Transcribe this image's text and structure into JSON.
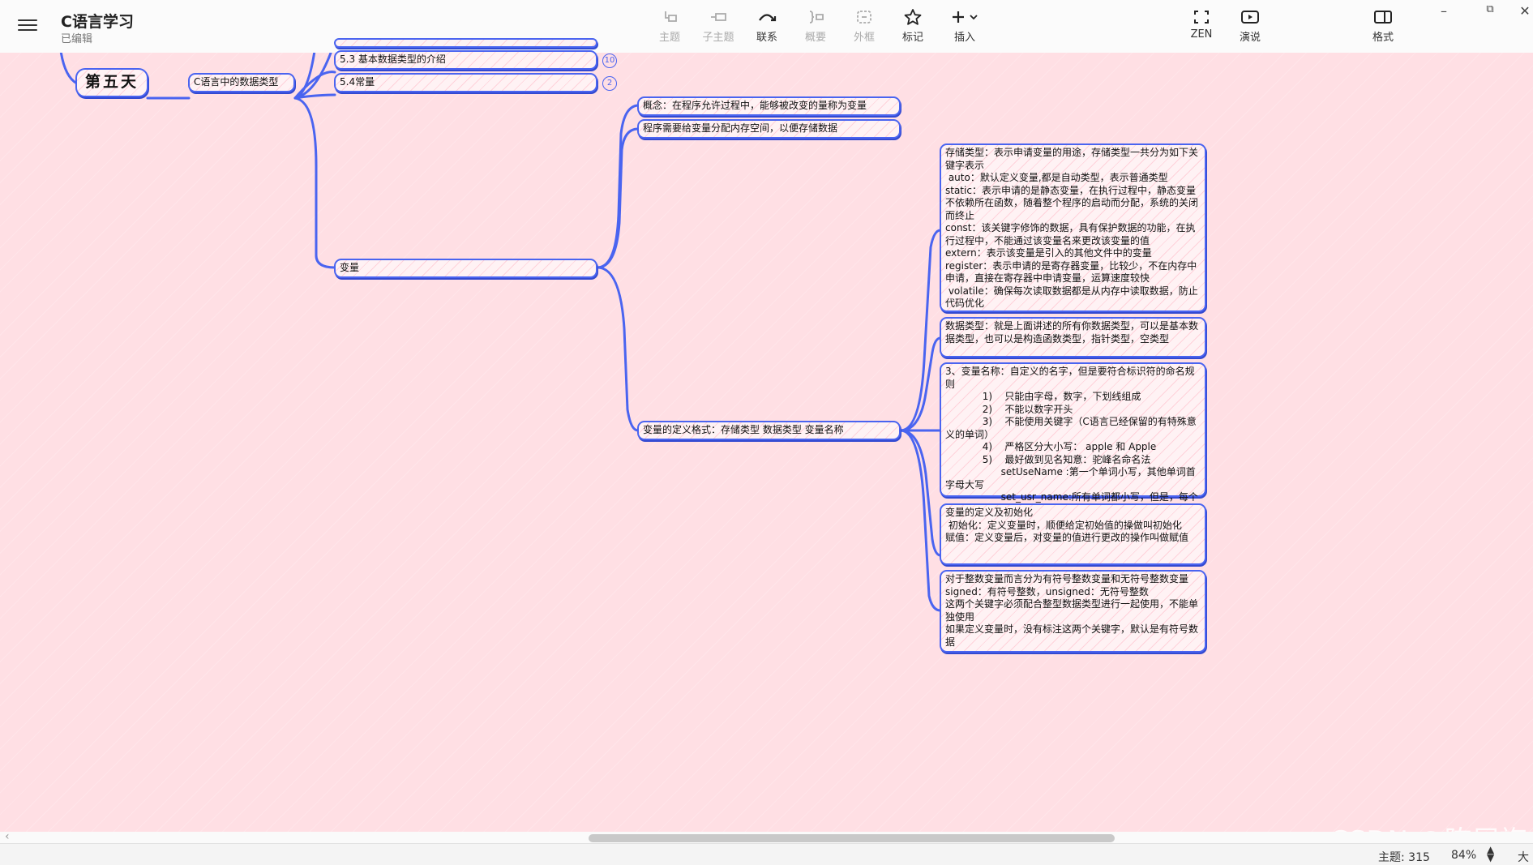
{
  "app": {
    "title": "C语言学习",
    "status": "已编辑"
  },
  "toolbar": {
    "items": [
      {
        "label": "主题",
        "icon": "topic-icon",
        "enabled": false
      },
      {
        "label": "子主题",
        "icon": "subtopic-icon",
        "enabled": false
      },
      {
        "label": "联系",
        "icon": "relationship-icon",
        "enabled": true
      },
      {
        "label": "概要",
        "icon": "summary-icon",
        "enabled": false
      },
      {
        "label": "外框",
        "icon": "boundary-icon",
        "enabled": false
      },
      {
        "label": "标记",
        "icon": "star-icon",
        "enabled": true
      },
      {
        "label": "插入",
        "icon": "plus-icon",
        "enabled": true
      },
      {
        "label": "ZEN",
        "icon": "fullscreen-icon",
        "enabled": true
      },
      {
        "label": "演说",
        "icon": "play-icon",
        "enabled": true
      },
      {
        "label": "格式",
        "icon": "format-panel-icon",
        "enabled": true
      }
    ]
  },
  "mindmap": {
    "root": "第五天",
    "branch": "C语言中的数据类型",
    "topic_53": "5.3 基本数据类型的介绍",
    "topic_53_count": "10",
    "topic_54": "5.4常量",
    "topic_54_count": "2",
    "variable": "变量",
    "concept": "概念：在程序允许过程中，能够被改变的量称为变量",
    "memory": "程序需要给变量分配内存空间，以便存储数据",
    "definition": "变量的定义格式：存储类型 数据类型 变量名称",
    "storage": [
      "存储类型：表示申请变量的用途，存储类型一共分为如下关键字表示",
      " auto：默认定义变量,都是自动类型，表示普通类型",
      "static：表示申请的是静态变量，在执行过程中，静态变量不依赖所在函数，随着整个程序的启动而分配，系统的关闭而终止",
      "const：该关键字修饰的数据，具有保护数据的功能，在执行过程中，不能通过该变量名来更改该变量的值",
      "extern：表示该变量是引入的其他文件中的变量",
      "register：表示申请的是寄存器变量，比较少，不在内存中申请，直接在寄存器中申请变量，运算速度较快",
      " volatile：确保每次读取数据都是从内存中读取数据，防止代码优化"
    ],
    "datatype": [
      "数据类型：就是上面讲述的所有你数据类型，可以是基本数据类型，也可以是构造函数类型，指针类型，空类型"
    ],
    "naming": [
      "3、变量名称：自定义的名字，但是要符合标识符的命名规则",
      "            1)    只能由字母，数字，下划线组成",
      "            2)    不能以数字开头",
      "            3)    不能使用关键字（C语言已经保留的有特殊意义的单词）",
      "            4)    严格区分大小写： apple 和 Apple",
      "            5)    最好做到见名知意：驼峰名命名法",
      "                  setUseName :第一个单词小写，其他单词首字母大写",
      "                  set_usr_name:所有单词都小写，但是，每个单词中级使用下划线隔开"
    ],
    "init": [
      "变量的定义及初始化",
      " 初始化：定义变量时，顺便给定初始值的操做叫初始化",
      "赋值：定义变量后，对变量的值进行更改的操作叫做赋值"
    ],
    "signed": [
      "对于整数变量而言分为有符号整数变量和无符号整数变量",
      "signed：有符号整数，unsigned：无符号整数",
      "这两个关键字必须配合整型数据类型进行一起使用，不能单独使用",
      "如果定义变量时，没有标注这两个关键字，默认是有符号数据"
    ]
  },
  "colors": {
    "canvas": "#ffdfe4",
    "line": "#4a64f0",
    "node_fill": "#fff2f4"
  },
  "statusbar": {
    "topics": "主题: 315",
    "zoom": "84%",
    "size": "大"
  },
  "watermark": "CSDN @陈展旗"
}
